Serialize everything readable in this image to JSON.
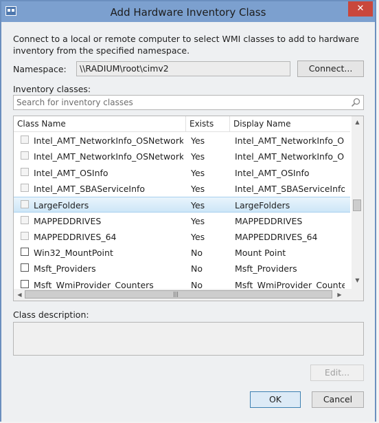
{
  "window": {
    "title": "Add Hardware Inventory Class",
    "close_glyph": "✕"
  },
  "intro_text": "Connect to a local or remote computer to select WMI classes to add to hardware inventory from the specified namespace.",
  "namespace": {
    "label": "Namespace:",
    "value": "\\\\RADIUM\\root\\cimv2",
    "connect_label": "Connect..."
  },
  "inventory": {
    "label": "Inventory classes:",
    "search_placeholder": "Search for inventory classes",
    "columns": [
      "Class Name",
      "Exists",
      "Display Name"
    ],
    "rows": [
      {
        "class_name": "Intel_AMT_NetworkInfo_OSNetwork",
        "exists": "Yes",
        "display_name": "Intel_AMT_NetworkInfo_OSNe",
        "checked": false,
        "disabled": true,
        "selected": false
      },
      {
        "class_name": "Intel_AMT_NetworkInfo_OSNetwork_OSW",
        "exists": "Yes",
        "display_name": "Intel_AMT_NetworkInfo_OSNe",
        "checked": false,
        "disabled": true,
        "selected": false
      },
      {
        "class_name": "Intel_AMT_OSInfo",
        "exists": "Yes",
        "display_name": "Intel_AMT_OSInfo",
        "checked": false,
        "disabled": true,
        "selected": false
      },
      {
        "class_name": "Intel_AMT_SBAServiceInfo",
        "exists": "Yes",
        "display_name": "Intel_AMT_SBAServiceInfo",
        "checked": false,
        "disabled": true,
        "selected": false
      },
      {
        "class_name": "LargeFolders",
        "exists": "Yes",
        "display_name": "LargeFolders",
        "checked": false,
        "disabled": true,
        "selected": true
      },
      {
        "class_name": "MAPPEDDRIVES",
        "exists": "Yes",
        "display_name": "MAPPEDDRIVES",
        "checked": false,
        "disabled": true,
        "selected": false
      },
      {
        "class_name": "MAPPEDDRIVES_64",
        "exists": "Yes",
        "display_name": "MAPPEDDRIVES_64",
        "checked": false,
        "disabled": true,
        "selected": false
      },
      {
        "class_name": "Win32_MountPoint",
        "exists": "No",
        "display_name": "Mount Point",
        "checked": false,
        "disabled": false,
        "selected": false
      },
      {
        "class_name": "Msft_Providers",
        "exists": "No",
        "display_name": "Msft_Providers",
        "checked": false,
        "disabled": false,
        "selected": false
      },
      {
        "class_name": "Msft_WmiProvider_Counters",
        "exists": "No",
        "display_name": "Msft_WmiProvider_Counters",
        "checked": false,
        "disabled": false,
        "selected": false
      }
    ]
  },
  "class_description": {
    "label": "Class description:",
    "value": ""
  },
  "buttons": {
    "edit_label": "Edit...",
    "ok_label": "OK",
    "cancel_label": "Cancel"
  },
  "scrollbar_glyphs": {
    "up": "▲",
    "down": "▼",
    "left": "◀",
    "right": "▶",
    "grip": "|||"
  },
  "colors": {
    "titlebar": "#7ca0cf",
    "close_button": "#c9473c",
    "selection": "#cde6f7"
  }
}
